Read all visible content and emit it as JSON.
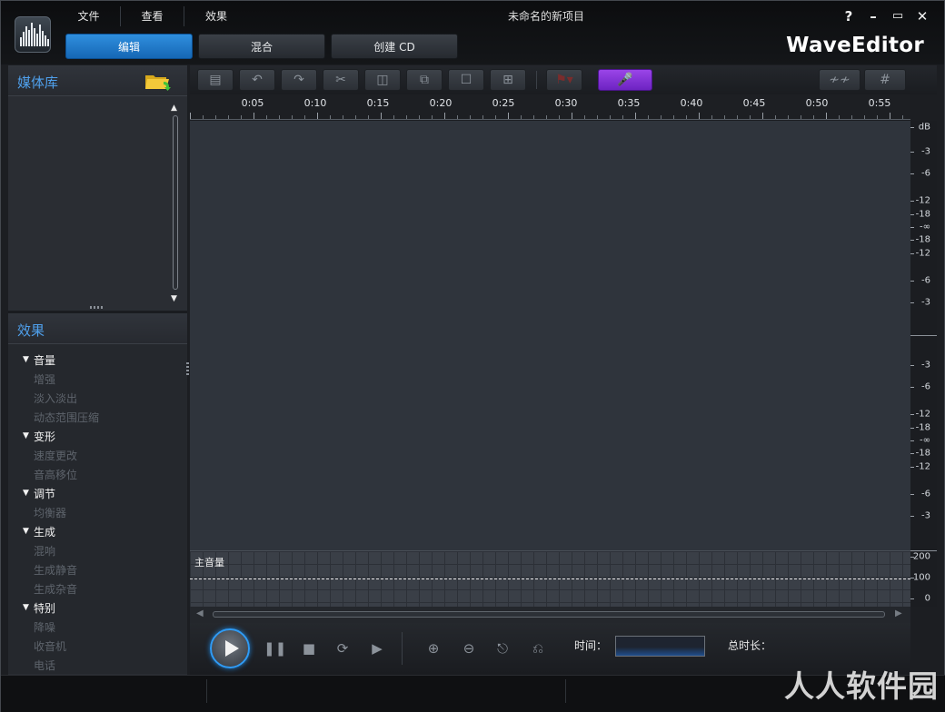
{
  "app": {
    "title": "未命名的新项目",
    "brand": "WaveEditor"
  },
  "menu": [
    "文件",
    "查看",
    "效果"
  ],
  "window_controls": [
    "?",
    "–",
    "▭",
    "✕"
  ],
  "mode_tabs": [
    {
      "label": "编辑",
      "active": true
    },
    {
      "label": "混合",
      "active": false
    },
    {
      "label": "创建 CD",
      "active": false
    }
  ],
  "media_library": {
    "title": "媒体库",
    "scroll_up": "▲",
    "scroll_down": "▼"
  },
  "effects": {
    "title": "效果",
    "categories": [
      {
        "name": "音量",
        "items": [
          "增强",
          "淡入淡出",
          "动态范围压缩"
        ]
      },
      {
        "name": "变形",
        "items": [
          "速度更改",
          "音高移位"
        ]
      },
      {
        "name": "调节",
        "items": [
          "均衡器"
        ]
      },
      {
        "name": "生成",
        "items": [
          "混响",
          "生成静音",
          "生成杂音"
        ]
      },
      {
        "name": "特别",
        "items": [
          "降噪",
          "收音机",
          "电话"
        ]
      }
    ]
  },
  "toolbar": {
    "icons": [
      "save-icon",
      "undo-icon",
      "redo-icon",
      "cut-icon",
      "paste-icon",
      "copy-icon",
      "delete-icon",
      "crop-icon",
      "flag-icon",
      "microphone-icon",
      "waveform-icon",
      "grid-icon"
    ],
    "mic_color": "#8a3ae0"
  },
  "timeline": {
    "ticks": [
      "0:05",
      "0:10",
      "0:15",
      "0:20",
      "0:25",
      "0:30",
      "0:35",
      "0:40",
      "0:45",
      "0:50",
      "0:55"
    ]
  },
  "db_scale": {
    "unit": "dB",
    "upper": [
      "-3",
      "-6",
      "-12",
      "-18",
      "-∞",
      "-18",
      "-12",
      "-6",
      "-3"
    ],
    "lower": [
      "-3",
      "-6",
      "-12",
      "-18",
      "-∞",
      "-18",
      "-12",
      "-6",
      "-3"
    ],
    "master": [
      "200",
      "100",
      "0"
    ]
  },
  "master_track": {
    "label": "主音量"
  },
  "transport": {
    "time_label": "时间：",
    "time_value": "",
    "total_label": "总时长：",
    "total_value": "",
    "accent": "#2f9bf5"
  },
  "watermark": "人人软件园"
}
